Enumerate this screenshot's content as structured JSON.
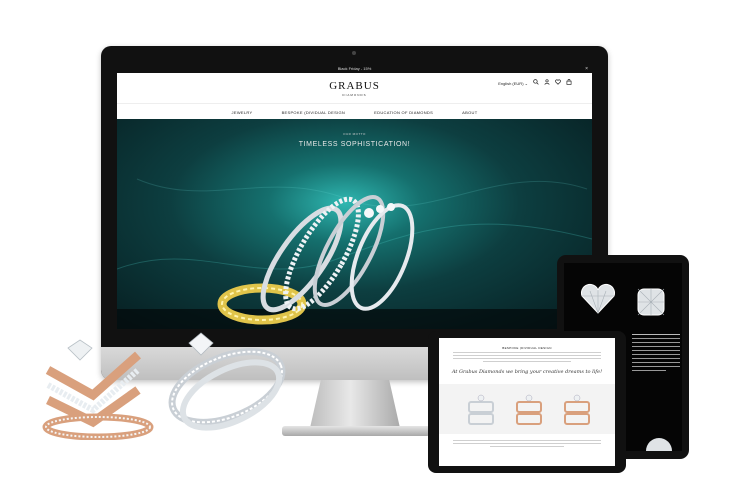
{
  "announcement": {
    "text": "Black Friday - 15%",
    "close": "×"
  },
  "brand": {
    "name": "GRABUS",
    "tagline": "DIAMONDS"
  },
  "header": {
    "language": "English (EUR) ⌄"
  },
  "nav": {
    "items": [
      "JEWELRY",
      "BESPOKE (DIVIDUAL DESIGN",
      "EDUCATION OF DIAMONDS",
      "ABOUT"
    ]
  },
  "hero": {
    "eyebrow": "OUR MOTTO",
    "title": "TIMELESS SOPHISTICATION!"
  },
  "tablet_front": {
    "heading": "BESPOKE (DIVIDUAL DESIGN",
    "script_line": "At Grabus Diamonds we bring your creative dreams to life!"
  },
  "colors": {
    "hero_teal": "#15706e",
    "hero_dark": "#061b1e",
    "gold": "#e0c44a",
    "rose_gold": "#d9a07d",
    "white_metal": "#d8dde2"
  },
  "icons": {
    "search": "search-icon",
    "account": "user-icon",
    "wishlist": "heart-icon",
    "cart": "bag-icon"
  }
}
